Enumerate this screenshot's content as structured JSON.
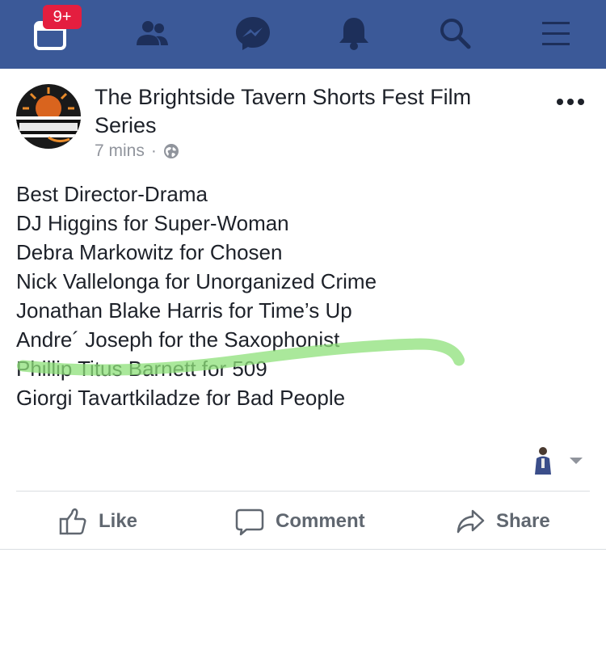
{
  "nav": {
    "badge": "9+",
    "icons": [
      "calendar-icon",
      "friends-icon",
      "messenger-icon",
      "bell-icon",
      "search-icon",
      "menu-icon"
    ]
  },
  "post": {
    "page_name": "The Brightside Tavern Shorts Fest Film Series",
    "time": "7 mins",
    "separator": "·",
    "lines": [
      "Best Director-Drama",
      "DJ Higgins for Super-Woman",
      "Debra Markowitz for Chosen",
      "Nick Vallelonga for Unorganized Crime",
      "Jonathan Blake Harris for Time’s Up",
      "Andre´ Joseph for the Saxophonist",
      "Phillip Titus Barnett for 509",
      "Giorgi Tavartkiladze for Bad People"
    ],
    "highlight_color": "#8ee07a"
  },
  "actions": {
    "like": "Like",
    "comment": "Comment",
    "share": "Share"
  },
  "colors": {
    "topbar": "#3b5998",
    "badge": "#e41e3f",
    "text": "#1d2129",
    "muted": "#90949c",
    "action": "#606770"
  }
}
